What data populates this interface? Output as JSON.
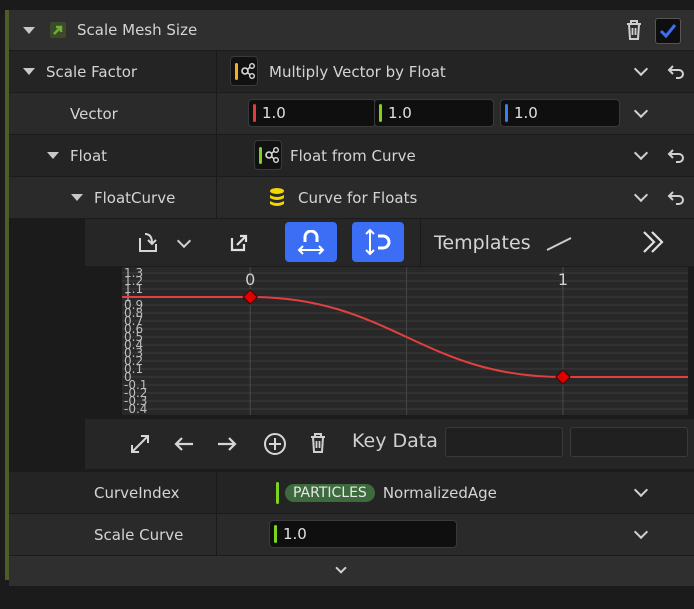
{
  "colors": {
    "accent": "#3b6ef5",
    "orange_stripe": "#f0b020",
    "green_stripe": "#7ed321",
    "red_stripe": "#e23b3b",
    "blue_stripe": "#3a7df0",
    "curve": "#e04040",
    "key": "#e00000",
    "pill": "#3d6b3d"
  },
  "header": {
    "title": "Scale Mesh Size"
  },
  "scale_factor": {
    "label": "Scale Factor",
    "value": "Multiply Vector by Float"
  },
  "vector": {
    "label": "Vector",
    "x": "1.0",
    "y": "1.0",
    "z": "1.0"
  },
  "float": {
    "label": "Float",
    "value": "Float from Curve"
  },
  "float_curve": {
    "label": "FloatCurve",
    "value": "Curve for Floats"
  },
  "curve_toolbar": {
    "templates_label": "Templates"
  },
  "curve_editor": {
    "y_ticks": [
      "1.3",
      "1.2",
      "1.1",
      "1",
      "0.9",
      "0.8",
      "0.7",
      "0.6",
      "0.5",
      "0.4",
      "0.3",
      "0.2",
      "0.1",
      "0",
      "-0.1",
      "-0.2",
      "-0.3",
      "-0.4"
    ],
    "x_ticks": [
      "0",
      "1"
    ]
  },
  "chart_data": {
    "type": "line",
    "x": [
      0,
      1
    ],
    "y": [
      1.0,
      0.0
    ],
    "xlim": [
      -0.41,
      1.4
    ],
    "ylim": [
      -0.4,
      1.3
    ],
    "x_ticks": [
      "0",
      "1"
    ],
    "grid": true
  },
  "key_bar": {
    "label": "Key Data",
    "time_value": "",
    "value_value": ""
  },
  "curve_index": {
    "label": "CurveIndex",
    "namespace": "PARTICLES",
    "value": "NormalizedAge"
  },
  "scale_curve": {
    "label": "Scale Curve",
    "value": "1.0"
  }
}
